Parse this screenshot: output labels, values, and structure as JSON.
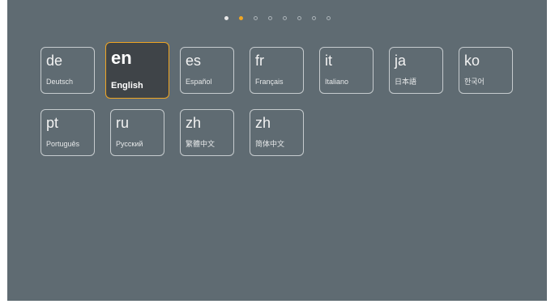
{
  "pager": {
    "pages": 8,
    "current_page": 2
  },
  "colors": {
    "background": "#5f6b72",
    "accent": "#f0a623",
    "selected_tile": "#3f4448"
  },
  "languages": [
    {
      "code": "de",
      "name": "Deutsch"
    },
    {
      "code": "en",
      "name": "English",
      "selected": true
    },
    {
      "code": "es",
      "name": "Español"
    },
    {
      "code": "fr",
      "name": "Français"
    },
    {
      "code": "it",
      "name": "Italiano"
    },
    {
      "code": "ja",
      "name": "日本語"
    },
    {
      "code": "ko",
      "name": "한국어"
    },
    {
      "code": "pt",
      "name": "Português"
    },
    {
      "code": "ru",
      "name": "Русский"
    },
    {
      "code": "zh",
      "name": "繁體中文"
    },
    {
      "code": "zh",
      "name": "简体中文"
    }
  ]
}
